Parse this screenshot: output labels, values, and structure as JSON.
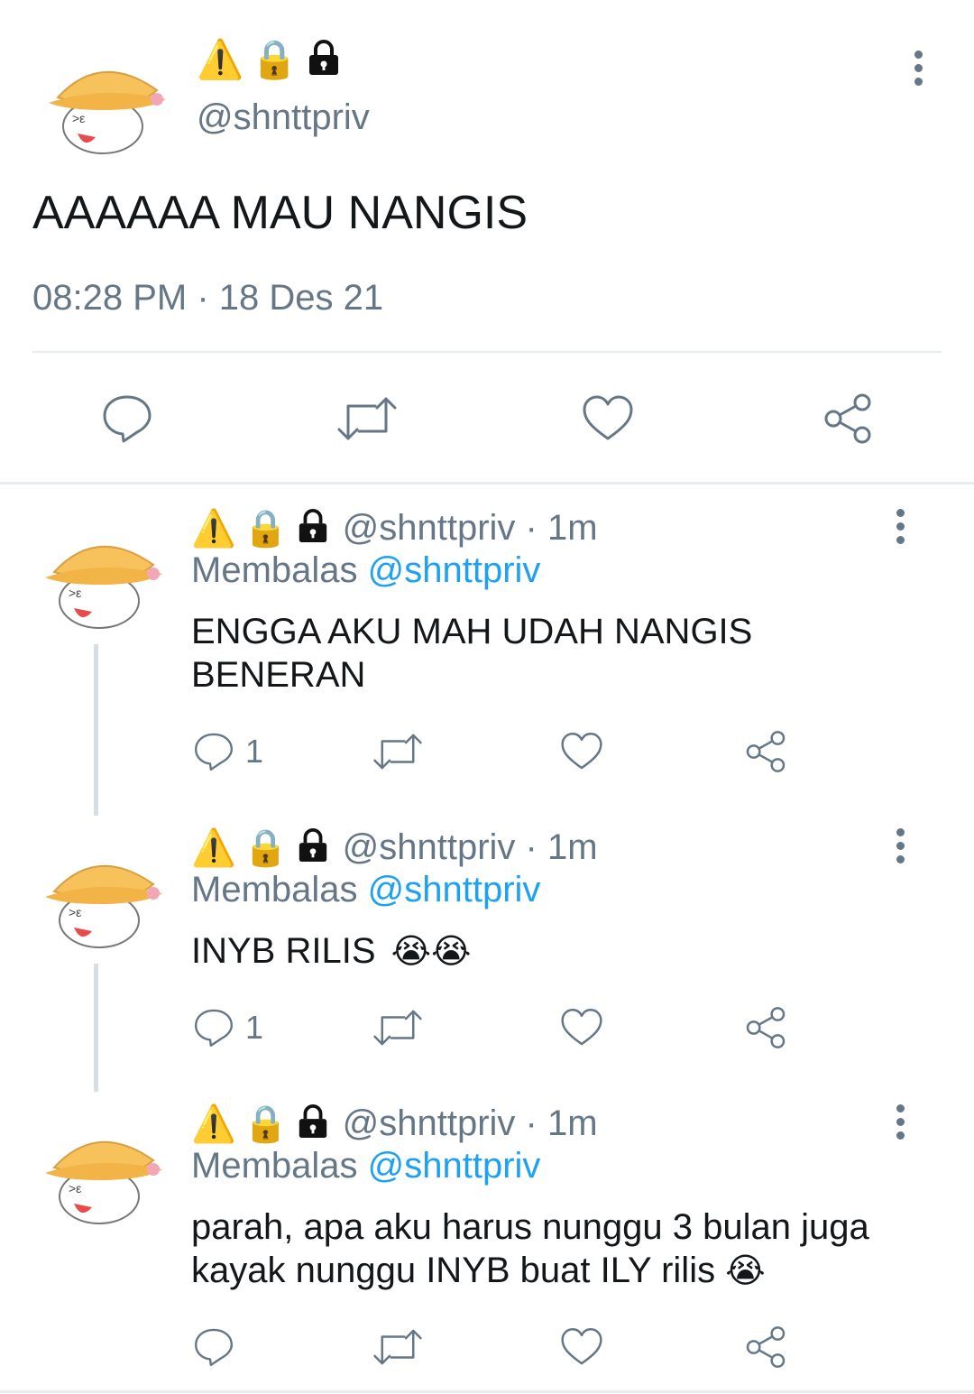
{
  "colors": {
    "accent": "#1da1f2",
    "muted": "#657786",
    "text": "#14171a"
  },
  "main_tweet": {
    "name_icons": [
      "warning-icon",
      "lock-icon",
      "lock-icon"
    ],
    "handle": "@shnttpriv",
    "text": "AAAAAA MAU NANGIS",
    "timestamp": "08:28 PM · 18 Des 21"
  },
  "replies": [
    {
      "handle_time": "@shnttpriv · 1m",
      "replying_label": "Membalas",
      "replying_to": "@shnttpriv",
      "text_lines": [
        "ENGGA AKU MAH UDAH NANGIS",
        "BENERAN"
      ],
      "reply_count": "1"
    },
    {
      "handle_time": "@shnttpriv · 1m",
      "replying_label": "Membalas",
      "replying_to": "@shnttpriv",
      "text": "INYB RILIS",
      "emojis": "😭😭",
      "reply_count": "1"
    },
    {
      "handle_time": "@shnttpriv · 1m",
      "replying_label": "Membalas",
      "replying_to": "@shnttpriv",
      "text_line1": "parah, apa aku harus nunggu 3 bulan juga",
      "text_line2": "kayak nunggu INYB buat ILY rilis",
      "emoji": "😭",
      "reply_count": ""
    }
  ]
}
